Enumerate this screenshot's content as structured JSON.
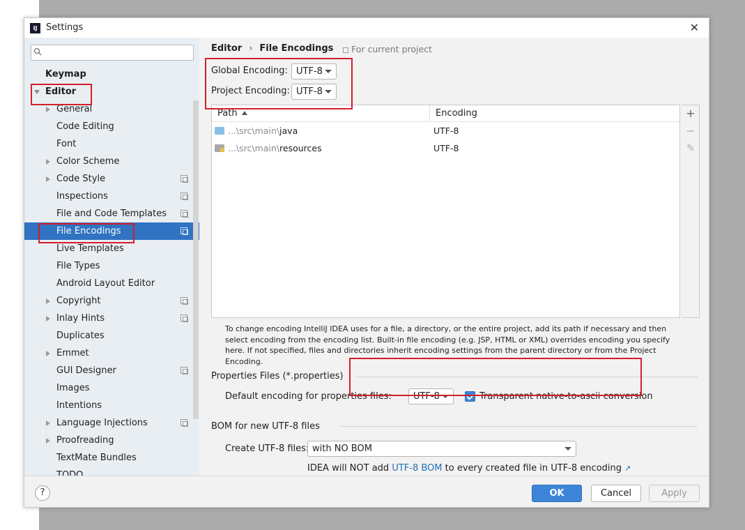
{
  "window": {
    "title": "Settings",
    "app_logo": "IJ",
    "close_glyph": "✕"
  },
  "search": {
    "placeholder": ""
  },
  "sidebar": {
    "items": [
      {
        "label": "Keymap"
      },
      {
        "label": "Editor"
      },
      {
        "label": "General"
      },
      {
        "label": "Code Editing"
      },
      {
        "label": "Font"
      },
      {
        "label": "Color Scheme"
      },
      {
        "label": "Code Style"
      },
      {
        "label": "Inspections"
      },
      {
        "label": "File and Code Templates"
      },
      {
        "label": "File Encodings"
      },
      {
        "label": "Live Templates"
      },
      {
        "label": "File Types"
      },
      {
        "label": "Android Layout Editor"
      },
      {
        "label": "Copyright"
      },
      {
        "label": "Inlay Hints"
      },
      {
        "label": "Duplicates"
      },
      {
        "label": "Emmet"
      },
      {
        "label": "GUI Designer"
      },
      {
        "label": "Images"
      },
      {
        "label": "Intentions"
      },
      {
        "label": "Language Injections"
      },
      {
        "label": "Proofreading"
      },
      {
        "label": "TextMate Bundles"
      },
      {
        "label": "TODO"
      }
    ]
  },
  "breadcrumb": {
    "parent": "Editor",
    "separator": "›",
    "current": "File Encodings",
    "scope": "For current project"
  },
  "encodings": {
    "global_label": "Global Encoding:",
    "global_value": "UTF-8",
    "project_label": "Project Encoding:",
    "project_value": "UTF-8"
  },
  "table": {
    "col_path": "Path",
    "col_encoding": "Encoding",
    "rows": [
      {
        "prefix": "...\\src\\main\\",
        "name": "java",
        "encoding": "UTF-8",
        "icon": "folder-icon"
      },
      {
        "prefix": "...\\src\\main\\",
        "name": "resources",
        "encoding": "UTF-8",
        "icon": "resources-folder-icon"
      }
    ],
    "tools": {
      "add": "+",
      "remove": "−",
      "edit": "✎"
    }
  },
  "help_text": "To change encoding IntelliJ IDEA uses for a file, a directory, or the entire project, add its path if necessary and then select encoding from the encoding list. Built-in file encoding (e.g. JSP, HTML or XML) overrides encoding you specify here. If not specified, files and directories inherit encoding settings from the parent directory or from the Project Encoding.",
  "properties": {
    "section_title": "Properties Files (*.properties)",
    "default_label": "Default encoding for properties files:",
    "default_value": "UTF-8",
    "transparent_label": "Transparent native-to-ascii conversion",
    "transparent_checked": true
  },
  "bom": {
    "section_title": "BOM for new UTF-8 files",
    "create_label": "Create UTF-8 files:",
    "create_value": "with NO BOM",
    "note_before": "IDEA will NOT add ",
    "note_link": "UTF-8 BOM",
    "note_after": " to every created file in UTF-8 encoding",
    "note_ext": "↗"
  },
  "footer": {
    "help": "?",
    "ok": "OK",
    "cancel": "Cancel",
    "apply": "Apply"
  },
  "colors": {
    "accent": "#2f73c2",
    "highlight_box": "#d21f2b",
    "link": "#2470b3"
  }
}
